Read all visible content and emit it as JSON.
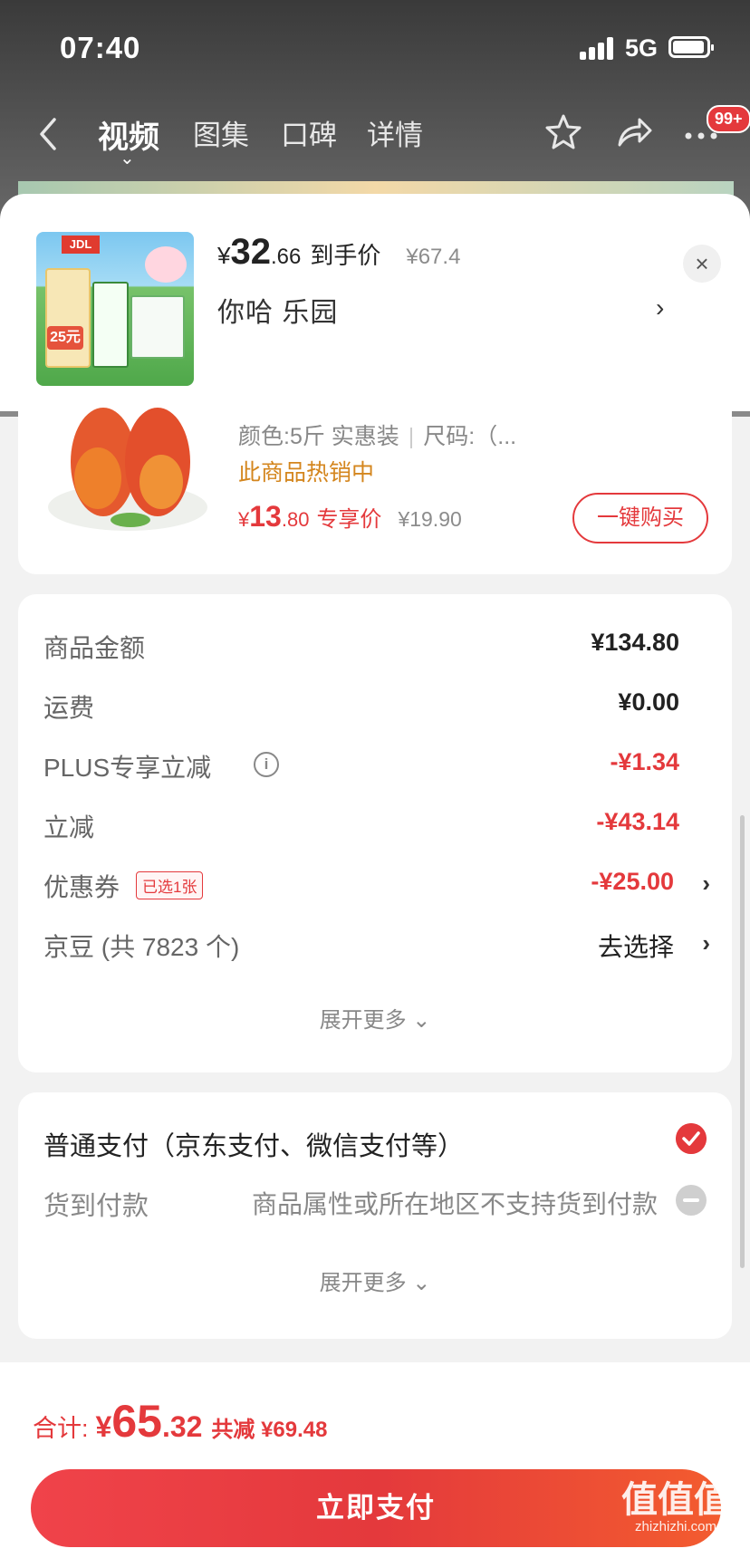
{
  "status_bar": {
    "time": "07:40",
    "network": "5G"
  },
  "nav": {
    "tabs": [
      "视频",
      "图集",
      "口碑",
      "详情"
    ],
    "active_tab": 0,
    "caret": "⌄",
    "badge": "99+"
  },
  "popup": {
    "price_yen": "¥",
    "price_int": "32",
    "price_dec": ".66",
    "price_label": "到手价",
    "original_price": "¥67.4",
    "name": "你哈  乐园",
    "arrow": "›",
    "close": "×",
    "thumb_logo": "JDL",
    "thumb_tag": "25元"
  },
  "product": {
    "spec_color": "颜色:5斤 实惠装",
    "spec_size": "尺码:（...",
    "hot": "此商品热销中",
    "price_yen": "¥",
    "price_int": "13",
    "price_dec": ".80",
    "price_label": "专享价",
    "original_price": "¥19.90",
    "buy_button": "一键购买"
  },
  "summary": {
    "rows": [
      {
        "label": "商品金额",
        "value": "¥134.80"
      },
      {
        "label": "运费",
        "value": "¥0.00"
      },
      {
        "label": "PLUS专享立减",
        "value": "-¥1.34"
      },
      {
        "label": "立减",
        "value": "-¥43.14"
      },
      {
        "label": "优惠券",
        "value": "-¥25.00",
        "tag": "已选1张"
      },
      {
        "label": "京豆 (共 7823 个)",
        "value": "去选择"
      }
    ],
    "info_icon": "i",
    "chevron": "›",
    "expand": "展开更多 ⌄"
  },
  "payment": {
    "options": [
      {
        "label": "普通支付（京东支付、微信支付等）"
      },
      {
        "label": "货到付款",
        "note": "商品属性或所在地区不支持货到付款"
      }
    ],
    "expand": "展开更多 ⌄"
  },
  "footer": {
    "total_label": "合计:",
    "total_yen": "¥",
    "total_int": "65",
    "total_dec": ".32",
    "saved": "共减 ¥69.48",
    "pay_button": "立即支付"
  },
  "watermark": {
    "text": "值值值",
    "sub": "zhizhizhi.com"
  },
  "colors": {
    "accent": "#e4393c",
    "hot": "#d4861e",
    "muted": "#888888"
  }
}
